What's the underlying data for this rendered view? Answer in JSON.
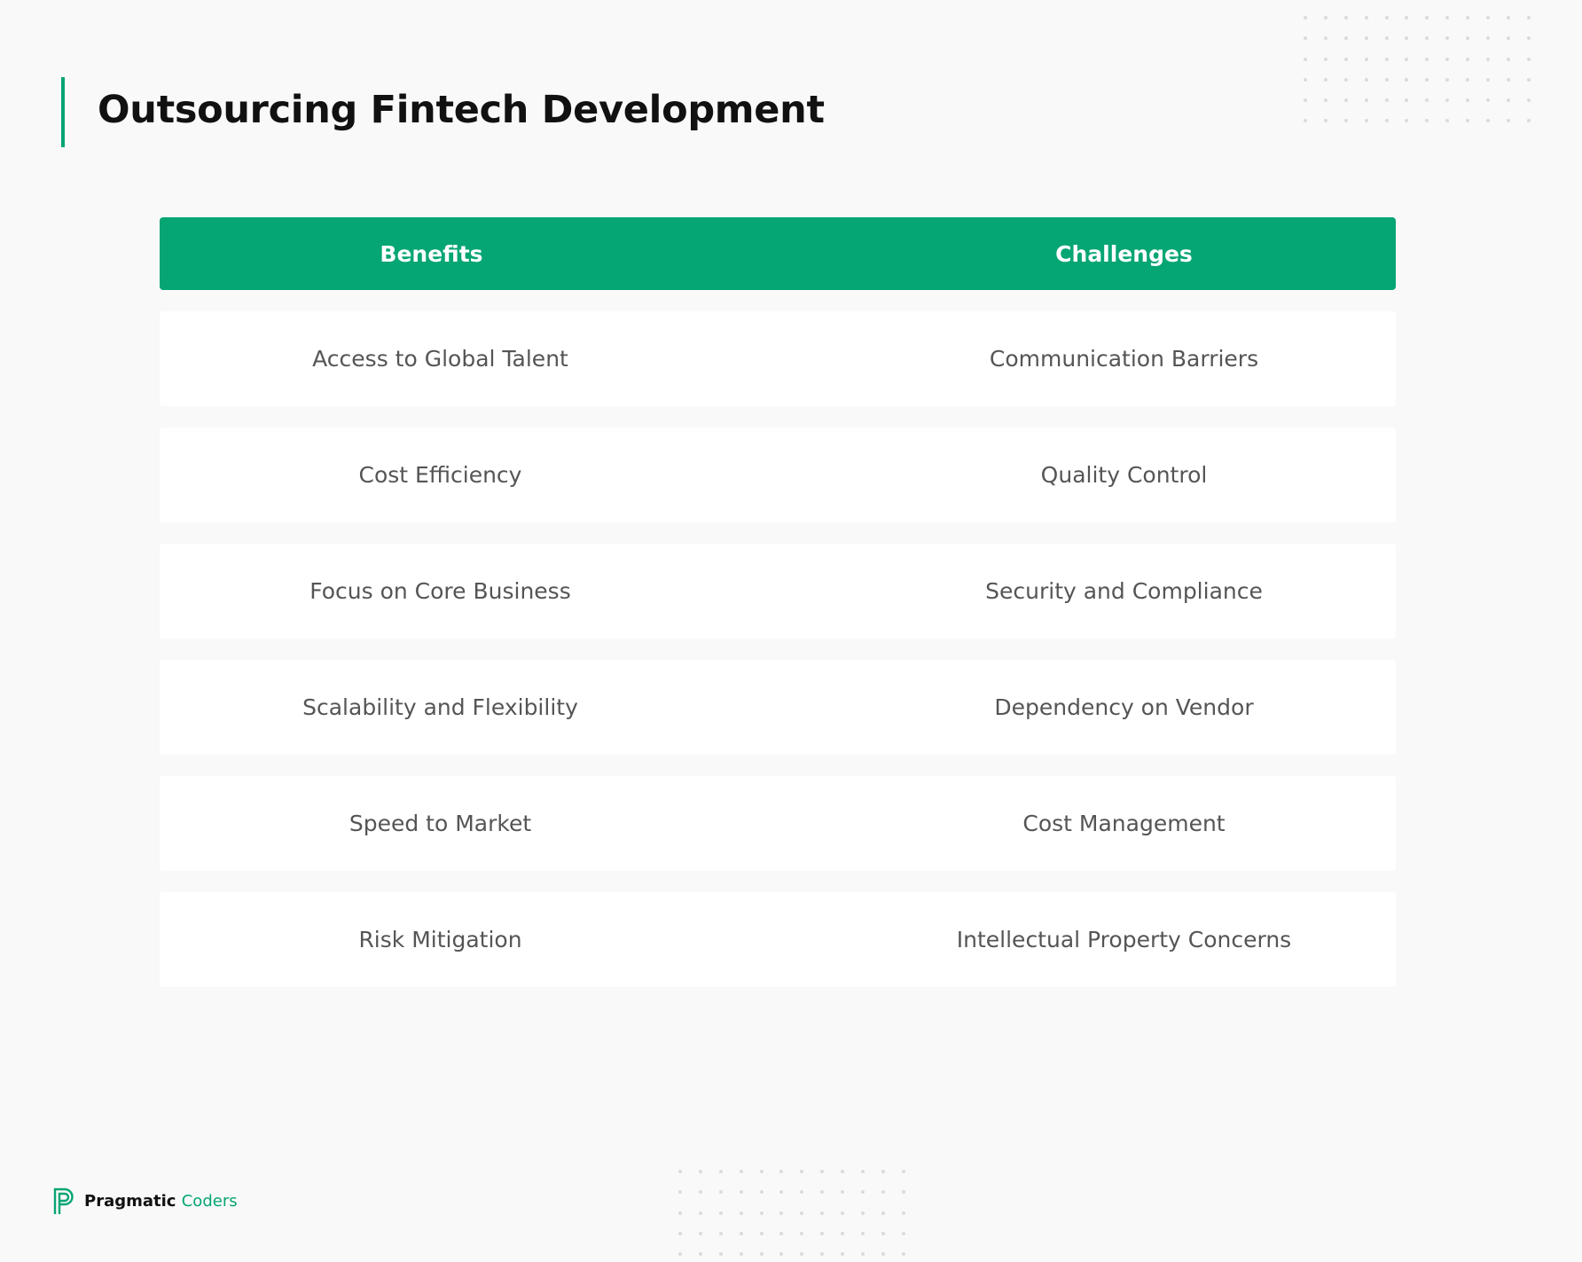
{
  "title": "Outsourcing Fintech Development",
  "colors": {
    "accent": "#05a574",
    "background": "#f9f9f9",
    "title_text": "#111111",
    "cell_text": "#555555"
  },
  "table": {
    "headers": {
      "benefits": "Benefits",
      "challenges": "Challenges"
    },
    "rows": [
      {
        "benefit": "Access to Global Talent",
        "challenge": "Communication Barriers"
      },
      {
        "benefit": "Cost Efficiency",
        "challenge": "Quality Control"
      },
      {
        "benefit": "Focus on Core Business",
        "challenge": "Security and Compliance"
      },
      {
        "benefit": "Scalability and Flexibility",
        "challenge": "Dependency on Vendor"
      },
      {
        "benefit": "Speed to Market",
        "challenge": "Cost Management"
      },
      {
        "benefit": "Risk Mitigation",
        "challenge": "Intellectual Property Concerns"
      }
    ]
  },
  "brand": {
    "icon": "pragmatic-coders-logo-icon",
    "name_first": "Pragmatic",
    "name_second": "Coders"
  }
}
